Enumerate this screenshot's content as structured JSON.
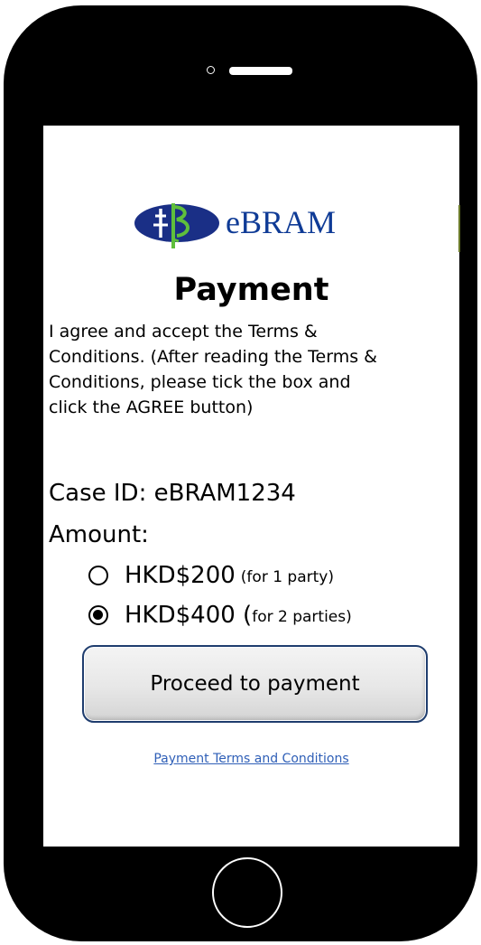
{
  "brand": {
    "logo_text": "eBRAM",
    "logo_color": "#0f3b96",
    "emblem_color": "#1a2f86",
    "emblem_accent_color": "#5fbf3b"
  },
  "page": {
    "title": "Payment",
    "terms_text": "I agree and accept the Terms &\nConditions. (After reading the Terms &\nConditions, please tick the box and\nclick the  AGREE button)"
  },
  "case": {
    "id_label": "Case ID: eBRAM1234"
  },
  "amount": {
    "label": "Amount:",
    "options": [
      {
        "value": "HKD$200",
        "note": "(for 1 party)",
        "selected": false
      },
      {
        "value": "HKD$400 (",
        "note": "for 2 parties)",
        "selected": true
      }
    ]
  },
  "actions": {
    "proceed_label": "Proceed to payment",
    "terms_link": "Payment Terms and Conditions",
    "link_color": "#2f5fb7"
  }
}
